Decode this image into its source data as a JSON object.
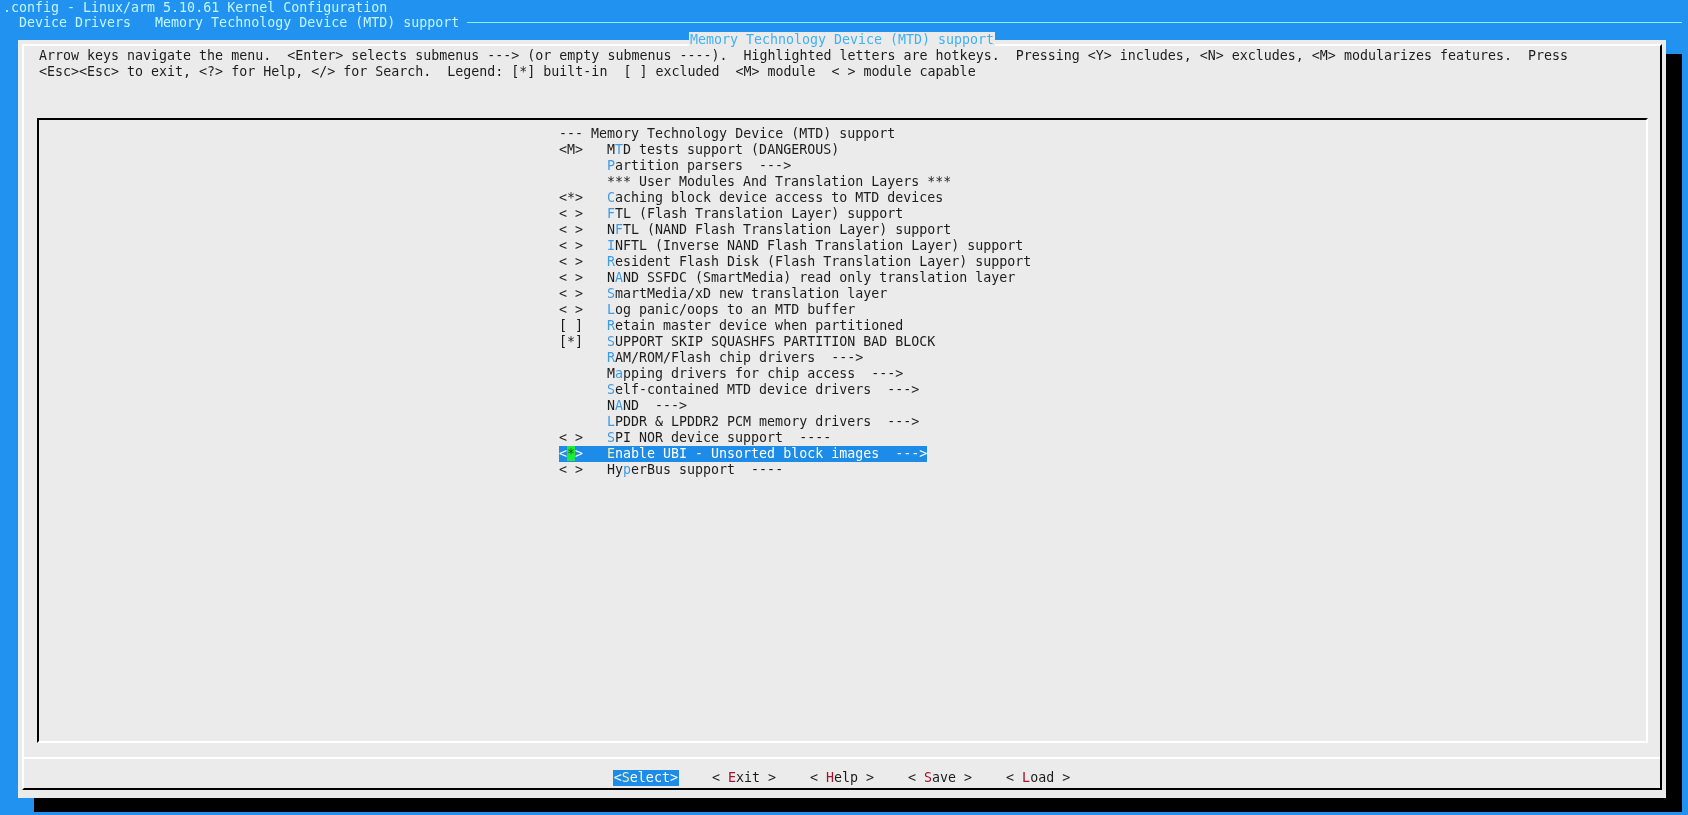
{
  "window": {
    "title": ".config - Linux/arm 5.10.61 Kernel Configuration"
  },
  "breadcrumb": [
    "Device Drivers",
    "Memory Technology Device (MTD) support"
  ],
  "dialog": {
    "title": "Memory Technology Device (MTD) support",
    "help_lines": [
      "Arrow keys navigate the menu.  <Enter> selects submenus ---> (or empty submenus ----).  Highlighted letters are hotkeys.  Pressing <Y> includes, <N> excludes, <M> modularizes features.  Press",
      "<Esc><Esc> to exit, <?> for Help, </> for Search.  Legend: [*] built-in  [ ] excluded  <M> module  < > module capable"
    ],
    "items": [
      {
        "kind": "header",
        "marker": "---",
        "text": "Memory Technology Device (MTD) support",
        "selected": false
      },
      {
        "kind": "option",
        "marker": "<M>",
        "hotkey_prefix": "M",
        "hotkey": "T",
        "text": "D tests support (DANGEROUS)",
        "selected": false
      },
      {
        "kind": "option",
        "hotkey": "P",
        "text": "artition parsers  --->",
        "selected": false
      },
      {
        "kind": "comment",
        "text": "*** User Modules And Translation Layers ***",
        "selected": false
      },
      {
        "kind": "option",
        "marker": "<*>",
        "hotkey": "C",
        "text": "aching block device access to MTD devices",
        "selected": false
      },
      {
        "kind": "option",
        "marker": "< >",
        "hotkey": "F",
        "text": "TL (Flash Translation Layer) support",
        "selected": false
      },
      {
        "kind": "option",
        "marker": "< >",
        "hotkey_prefix": "N",
        "hotkey": "F",
        "text": "TL (NAND Flash Translation Layer) support",
        "selected": false
      },
      {
        "kind": "option",
        "marker": "< >",
        "hotkey": "I",
        "text": "NFTL (Inverse NAND Flash Translation Layer) support",
        "selected": false
      },
      {
        "kind": "option",
        "marker": "< >",
        "hotkey": "R",
        "text": "esident Flash Disk (Flash Translation Layer) support",
        "selected": false
      },
      {
        "kind": "option",
        "marker": "< >",
        "hotkey_prefix": "N",
        "hotkey": "A",
        "text": "ND SSFDC (SmartMedia) read only translation layer",
        "selected": false
      },
      {
        "kind": "option",
        "marker": "< >",
        "hotkey": "S",
        "text": "martMedia/xD new translation layer",
        "selected": false
      },
      {
        "kind": "option",
        "marker": "< >",
        "hotkey": "L",
        "text": "og panic/oops to an MTD buffer",
        "selected": false
      },
      {
        "kind": "option",
        "marker": "[ ]",
        "hotkey": "R",
        "text": "etain master device when partitioned",
        "selected": false
      },
      {
        "kind": "option",
        "marker": "[*]",
        "hotkey": "S",
        "text": "UPPORT SKIP SQUASHFS PARTITION BAD BLOCK",
        "selected": false
      },
      {
        "kind": "option",
        "hotkey": "R",
        "text": "AM/ROM/Flash chip drivers  --->",
        "selected": false
      },
      {
        "kind": "option",
        "hotkey_prefix": "M",
        "hotkey": "a",
        "text": "pping drivers for chip access  --->",
        "selected": false
      },
      {
        "kind": "option",
        "hotkey": "S",
        "text": "elf-contained MTD device drivers  --->",
        "selected": false
      },
      {
        "kind": "option",
        "hotkey_prefix": "N",
        "hotkey": "A",
        "text": "ND  --->",
        "selected": false
      },
      {
        "kind": "option",
        "hotkey": "L",
        "text": "PDDR & LPDDR2 PCM memory drivers  --->",
        "selected": false
      },
      {
        "kind": "option",
        "marker": "< >",
        "hotkey": "S",
        "text": "PI NOR device support  ----",
        "selected": false
      },
      {
        "kind": "option",
        "marker": "<*>",
        "hotkey": "E",
        "text": "nable UBI - Unsorted block images  --->",
        "selected": true
      },
      {
        "kind": "option",
        "marker": "< >",
        "hotkey_prefix": "Hy",
        "hotkey": "p",
        "text": "erBus support  ----",
        "selected": false
      }
    ],
    "buttons": [
      {
        "prefix": "<",
        "hotkey": "S",
        "text": "elect>",
        "selected": true
      },
      {
        "prefix": "< ",
        "hotkey": "E",
        "text": "xit >",
        "selected": false
      },
      {
        "prefix": "< ",
        "hotkey": "H",
        "text": "elp >",
        "selected": false
      },
      {
        "prefix": "< ",
        "hotkey": "S",
        "text": "ave >",
        "selected": false
      },
      {
        "prefix": "< ",
        "hotkey": "L",
        "text": "oad >",
        "selected": false
      }
    ]
  }
}
